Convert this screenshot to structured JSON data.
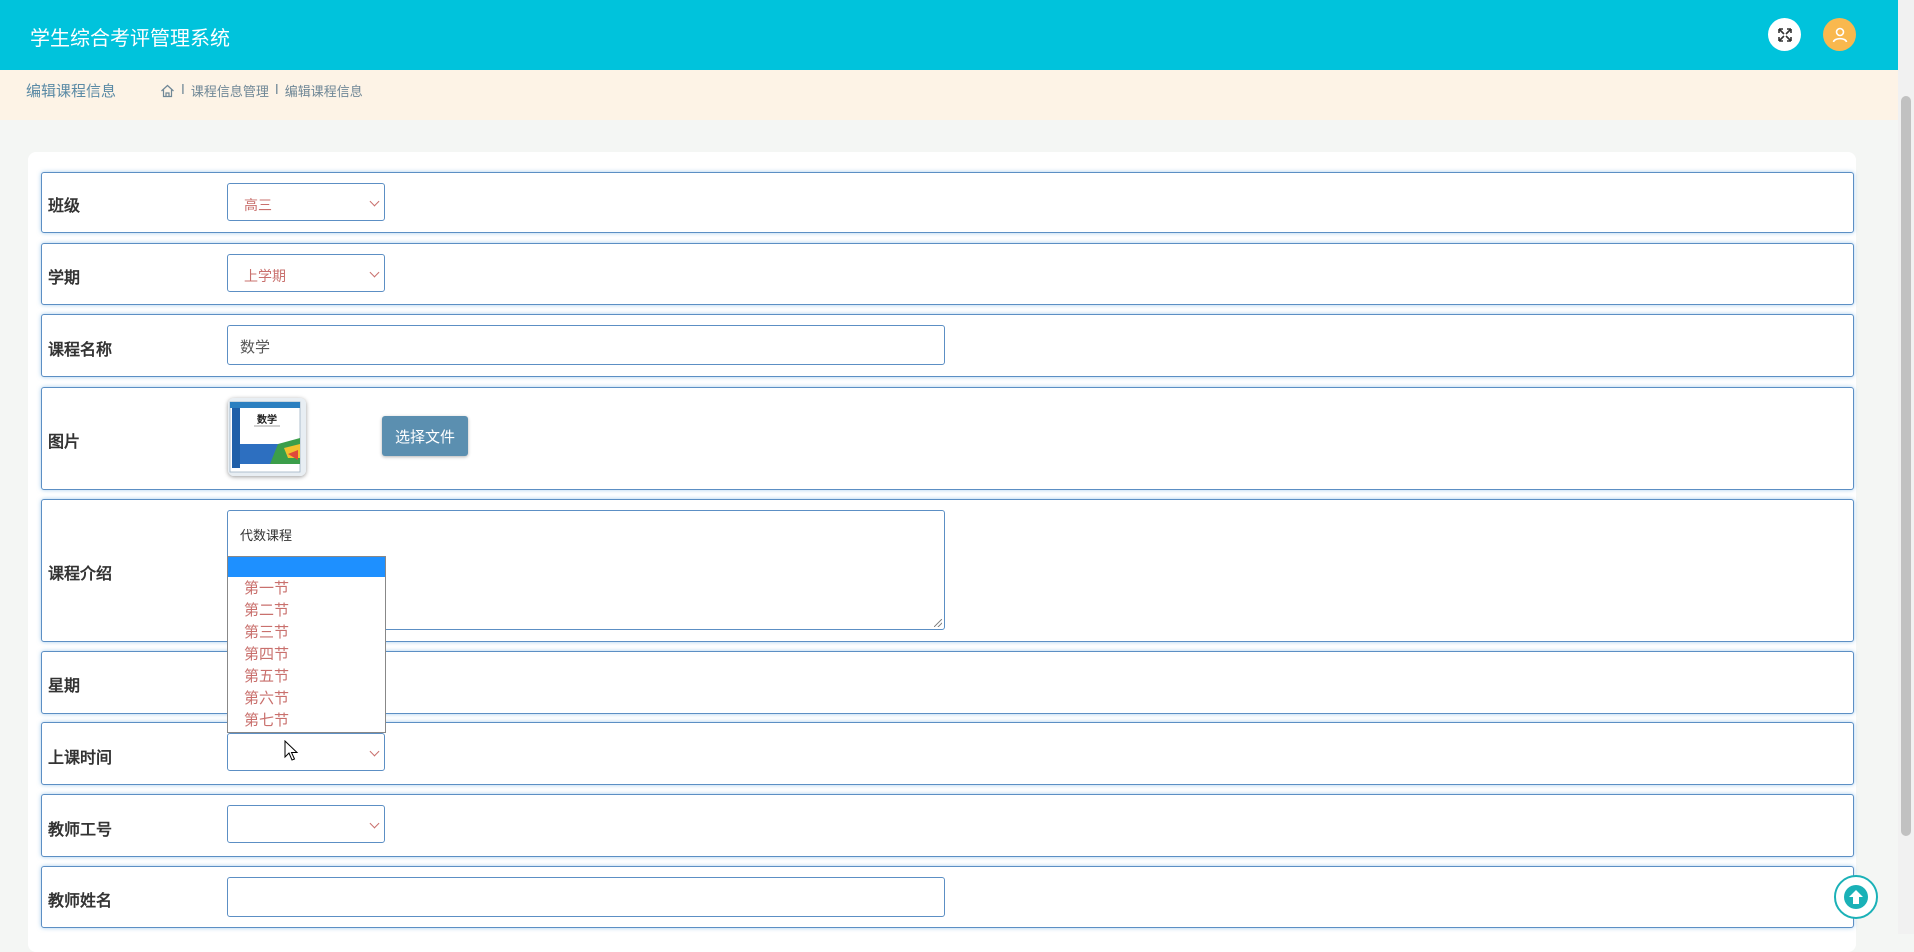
{
  "header": {
    "app_title": "学生综合考评管理系统",
    "fullscreen_icon": "fullscreen-icon",
    "user_icon": "user-icon"
  },
  "breadcrumb": {
    "page_title": "编辑课程信息",
    "home_icon": "home-icon",
    "separator": "I",
    "items": [
      "课程信息管理",
      "编辑课程信息"
    ]
  },
  "form": {
    "class": {
      "label": "班级",
      "value": "高三"
    },
    "term": {
      "label": "学期",
      "value": "上学期"
    },
    "course_name": {
      "label": "课程名称",
      "value": "数学"
    },
    "image": {
      "label": "图片",
      "choose_file_label": "选择文件",
      "cover_title": "数学"
    },
    "intro": {
      "label": "课程介绍",
      "value": "代数课程"
    },
    "weekday": {
      "label": "星期",
      "value": ""
    },
    "class_time": {
      "label": "上课时间",
      "value": ""
    },
    "teacher_id": {
      "label": "教师工号",
      "value": ""
    },
    "teacher_name": {
      "label": "教师姓名",
      "value": ""
    }
  },
  "dropdown": {
    "options": [
      "第一节",
      "第二节",
      "第三节",
      "第四节",
      "第五节",
      "第六节",
      "第七节"
    ]
  },
  "colors": {
    "header_bg": "#00c3dc",
    "breadcrumb_bg": "#fdf3e6",
    "row_border": "#5c8fc4",
    "select_text": "#c9706d",
    "button_bg": "#5b8fb0",
    "highlight": "#1e90ff"
  }
}
